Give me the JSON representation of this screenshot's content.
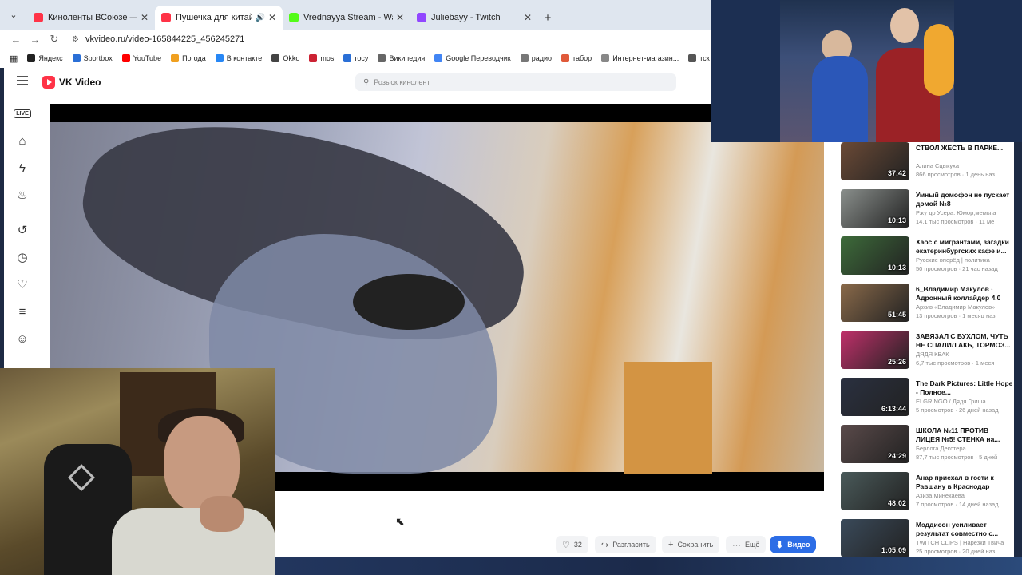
{
  "browser": {
    "tabs": [
      {
        "title": "Киноленты ВСоюзе — смотре",
        "color": "#ff3347",
        "active": false
      },
      {
        "title": "Пушечка для китайского р",
        "color": "#ff3347",
        "active": true
      },
      {
        "title": "Vrednayya Stream - Watch Live",
        "color": "#53fc18",
        "active": false
      },
      {
        "title": "Juliebayy - Twitch",
        "color": "#9146ff",
        "active": false
      }
    ],
    "url": "vkvideo.ru/video-165844225_456245271",
    "bookmarks": [
      {
        "label": "Яндекс",
        "color": "#222"
      },
      {
        "label": "Sportbox",
        "color": "#2a6fd6"
      },
      {
        "label": "YouTube",
        "color": "#ff0000"
      },
      {
        "label": "Погода",
        "color": "#f0a020"
      },
      {
        "label": "В контакте",
        "color": "#2787f5"
      },
      {
        "label": "Okko",
        "color": "#444"
      },
      {
        "label": "mos",
        "color": "#cc2233"
      },
      {
        "label": "госу",
        "color": "#2a6fd6"
      },
      {
        "label": "Википедия",
        "color": "#666"
      },
      {
        "label": "Google Переводчик",
        "color": "#4285f4"
      },
      {
        "label": "радио",
        "color": "#777"
      },
      {
        "label": "табор",
        "color": "#e05a3a"
      },
      {
        "label": "Интернет-магазин...",
        "color": "#888"
      },
      {
        "label": "тск заря",
        "color": "#555"
      }
    ]
  },
  "vk": {
    "brand": "VK Video",
    "search_placeholder": "Розыск кинолент"
  },
  "actions": {
    "likes": "32",
    "share": "Разгласить",
    "save": "Сохранить",
    "more": "Ещё",
    "video": "Видео"
  },
  "recommendations": [
    {
      "title": "СТВОЛ ЖЕСТЬ В ПАРКЕ...",
      "author": "Алина Сцыкуха",
      "meta": "866 просмотров · 1 день наз",
      "duration": "37:42",
      "thumb": "#6b4a36"
    },
    {
      "title": "Умный домофон не пускает домой №8",
      "author": "Ржу до Усера. Юмор,мемы,а",
      "meta": "14,1 тыс просмотров · 11 ме",
      "duration": "10:13",
      "thumb": "#8a8f8c"
    },
    {
      "title": "Хаос с мигрантами, загадки екатеринбургских кафе и...",
      "author": "Русские вперёд | политика",
      "meta": "50 просмотров · 21 час назад",
      "duration": "10:13",
      "thumb": "#3d6b3a"
    },
    {
      "title": "6_Владимир Макулов · Адронный коллайдер 4.0",
      "author": "Архив «Владимир Макулов»",
      "meta": "13 просмотров · 1 месяц наз",
      "duration": "51:45",
      "thumb": "#8a6a4a"
    },
    {
      "title": "ЗАВЯЗАЛ С БУХЛОМ, ЧУТЬ НЕ СПАЛИЛ АКБ, ТОРМОЗ...",
      "author": "ДЯДЯ КВАК",
      "meta": "6,7 тыс просмотров · 1 меся",
      "duration": "25:26",
      "thumb": "#c0306a"
    },
    {
      "title": "The Dark Pictures: Little Hope - Полное...",
      "author": "ELGRINGO / Дядя Гриша",
      "meta": "5 просмотров · 26 дней назад",
      "duration": "6:13:44",
      "thumb": "#2a3040"
    },
    {
      "title": "ШКОЛА №11 ПРОТИВ ЛИЦЕЯ №5! СТЕНКА на...",
      "author": "Берлога Декстера",
      "meta": "87,7 тыс просмотров · 5 дней",
      "duration": "24:29",
      "thumb": "#5a4a4a"
    },
    {
      "title": "Анар приехал в гости к Равшану в Краснодар",
      "author": "Азиза Минекаева",
      "meta": "7 просмотров · 14 дней назад",
      "duration": "48:02",
      "thumb": "#4a5a5a"
    },
    {
      "title": "Мэддисон усиливает результат совместно с...",
      "author": "TWITCH CLIPS | Нарезки Твича",
      "meta": "25 просмотров · 20 дней наз",
      "duration": "1:05:09",
      "thumb": "#3a4a5a"
    }
  ],
  "colors": {
    "accent": "#2c6de6",
    "brand": "#ff3347"
  }
}
